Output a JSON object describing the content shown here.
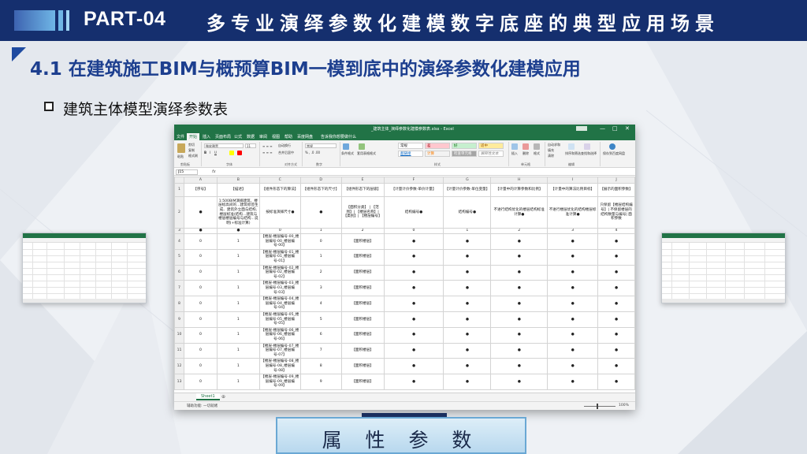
{
  "header": {
    "part_label": "PART-04",
    "title": "多专业演绎参数化建模数字底座的典型应用场景"
  },
  "section": {
    "title": "4.1 在建筑施工BIM与概预算BIM一模到底中的演绎参数化建模应用",
    "bullet": "建筑主体模型演绎参数表"
  },
  "banner": {
    "label": "属 性 参 数"
  },
  "colors": {
    "header_bg": "#152f6e",
    "accent": "#1d3f8f",
    "excel_green": "#217346"
  },
  "excel": {
    "title": "_建筑主体_演绎参数化建模参数表.xlsx - Excel",
    "window_controls": [
      "—",
      "□",
      "✕"
    ],
    "tabs": [
      "文件",
      "开始",
      "插入",
      "页面布局",
      "公式",
      "数据",
      "审阅",
      "视图",
      "帮助",
      "百度网盘",
      "告诉我你想要做什么"
    ],
    "active_tab": "开始",
    "ribbon": {
      "groups": [
        "剪贴板",
        "字体",
        "对齐方式",
        "数字",
        "样式",
        "单元格",
        "编辑"
      ],
      "font_name": "微软雅黑",
      "font_size": "11",
      "number_format": "常规",
      "styles": [
        {
          "label": "常规",
          "bg": "#ffffff",
          "fg": "#222222"
        },
        {
          "label": "差",
          "bg": "#ffc7ce",
          "fg": "#9c0006"
        },
        {
          "label": "好",
          "bg": "#c6efce",
          "fg": "#006100"
        },
        {
          "label": "适中",
          "bg": "#ffeb9c",
          "fg": "#9c5700"
        },
        {
          "label": "超链接",
          "bg": "#ffffff",
          "fg": "#0563c1"
        },
        {
          "label": "计算",
          "bg": "#f2f2f2",
          "fg": "#fa7d00"
        },
        {
          "label": "检查单元格",
          "bg": "#a5a5a5",
          "fg": "#ffffff"
        },
        {
          "label": "解释性文本",
          "bg": "#ffffff",
          "fg": "#7f7f7f"
        }
      ],
      "buttons": [
        "粘贴",
        "剪切",
        "复制",
        "格式刷",
        "自动换行",
        "合并后居中",
        "条件格式",
        "套用表格格式",
        "插入",
        "删除",
        "格式",
        "自动求和",
        "填充",
        "清除",
        "排序和筛选",
        "查找和选择",
        "保存到百度网盘"
      ]
    },
    "name_box": "J15",
    "fx": "fx",
    "columns": [
      "A",
      "B",
      "C",
      "D",
      "E",
      "F",
      "G",
      "H",
      "I",
      "J"
    ],
    "row_numbers": [
      "1",
      "2",
      "3",
      "4",
      "5",
      "6",
      "7",
      "8",
      "9",
      "10",
      "11",
      "12",
      "13"
    ],
    "row1": [
      "【序号】",
      "【描述】",
      "【组件形态下的算法】",
      "【组件形态下的尺寸】",
      "【组件形态下的层级】",
      "【计量计价参数-单价计量】",
      "【计量计价参数-单位变量】",
      "【计量中的计算参数和比例】",
      "【计量中的算法比例目标】",
      "【展示的面积参数】"
    ],
    "row2": [
      "●",
      "1:500BIM演绎建筑、楼层标高间的…建筑标签生成、建筑外立面与结构, 楼层标准(结构…建筑与楼层楼层编号与结构…说明(+标准计算)",
      "按标准演绎尺寸●",
      "●",
      "【面积分类】 | 【范围】| 【楼层名称】| 【类别】| 【楼层编号】",
      "结构编号●",
      "结构编号●",
      "不进行结构优化的楼层结构标准计算●",
      "不进行楼层优化的结构楼层标准计算●",
      "只保留【楼层结构编号】| 不保留楼层的结构数量与编号| 面积参数"
    ],
    "row3": [
      "●",
      "●",
      "0",
      "1",
      "2",
      "0",
      "1",
      "2",
      "3",
      "4"
    ],
    "data_rows": [
      {
        "a": "0",
        "b": "1",
        "c": "【楼层-楼层编号-00_楼层编号-00_楼层编号-00】",
        "d": "0",
        "e": "【面积楼层】",
        "f": "●",
        "g": "●",
        "h": "●",
        "i": "●",
        "j": "●"
      },
      {
        "a": "0",
        "b": "1",
        "c": "【楼层-楼层编号-01_楼层编号-01_楼层编号-01】",
        "d": "1",
        "e": "【面积楼层】",
        "f": "●",
        "g": "●",
        "h": "●",
        "i": "●",
        "j": "●"
      },
      {
        "a": "0",
        "b": "1",
        "c": "【楼层-楼层编号-02_楼层编号-02_楼层编号-02】",
        "d": "2",
        "e": "【面积楼层】",
        "f": "●",
        "g": "●",
        "h": "●",
        "i": "●",
        "j": "●"
      },
      {
        "a": "0",
        "b": "1",
        "c": "【楼层-楼层编号-03_楼层编号-03_楼层编号-03】",
        "d": "3",
        "e": "【面积楼层】",
        "f": "●",
        "g": "●",
        "h": "●",
        "i": "●",
        "j": "●"
      },
      {
        "a": "0",
        "b": "1",
        "c": "【楼层-楼层编号-04_楼层编号-04_楼层编号-04】",
        "d": "4",
        "e": "【面积楼层】",
        "f": "●",
        "g": "●",
        "h": "●",
        "i": "●",
        "j": "●"
      },
      {
        "a": "0",
        "b": "1",
        "c": "【楼层-楼层编号-05_楼层编号-05_楼层编号-05】",
        "d": "5",
        "e": "【面积楼层】",
        "f": "●",
        "g": "●",
        "h": "●",
        "i": "●",
        "j": "●"
      },
      {
        "a": "0",
        "b": "1",
        "c": "【楼层-楼层编号-06_楼层编号-06_楼层编号-06】",
        "d": "6",
        "e": "【面积楼层】",
        "f": "●",
        "g": "●",
        "h": "●",
        "i": "●",
        "j": "●"
      },
      {
        "a": "0",
        "b": "1",
        "c": "【楼层-楼层编号-07_楼层编号-07_楼层编号-07】",
        "d": "7",
        "e": "【面积楼层】",
        "f": "●",
        "g": "●",
        "h": "●",
        "i": "●",
        "j": "●"
      },
      {
        "a": "0",
        "b": "1",
        "c": "【楼层-楼层编号-08_楼层编号-08_楼层编号-08】",
        "d": "8",
        "e": "【面积楼层】",
        "f": "●",
        "g": "●",
        "h": "●",
        "i": "●",
        "j": "●"
      },
      {
        "a": "0",
        "b": "1",
        "c": "【楼层-楼层编号-09_楼层编号-09_楼层编号-09】",
        "d": "9",
        "e": "【面积楼层】",
        "f": "●",
        "g": "●",
        "h": "●",
        "i": "●",
        "j": "●"
      }
    ],
    "sheet_tab": "Sheet1",
    "sheet_add": "⊕",
    "status_text": "辅助功能: 一切就绪",
    "zoom_text": "100%"
  }
}
